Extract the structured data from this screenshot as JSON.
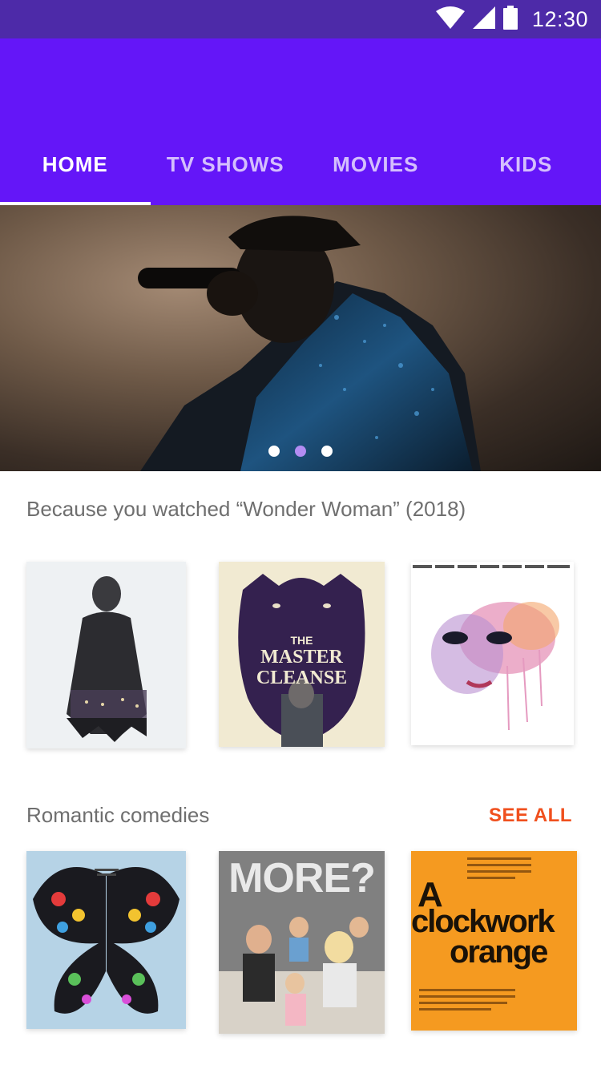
{
  "status_bar": {
    "time": "12:30",
    "icons": [
      "wifi-icon",
      "signal-icon",
      "battery-icon"
    ]
  },
  "tabs": [
    {
      "label": "HOME",
      "active": true
    },
    {
      "label": "TV SHOWS",
      "active": false
    },
    {
      "label": "MOVIES",
      "active": false
    },
    {
      "label": "KIDS",
      "active": false
    }
  ],
  "hero": {
    "slide_count": 3,
    "active_index": 1
  },
  "sections": [
    {
      "title": "Because you watched “Wonder Woman” (2018)",
      "posters": [
        {
          "name": "poster-man-in-coat"
        },
        {
          "name": "poster-master-cleanse",
          "title_line1": "THE",
          "title_line2": "MASTER",
          "title_line3": "CLEANSE"
        },
        {
          "name": "poster-watercolor-face"
        }
      ]
    },
    {
      "title": "Romantic comedies",
      "see_all": "SEE ALL",
      "posters": [
        {
          "name": "poster-butterfly"
        },
        {
          "name": "poster-more",
          "title": "MORE?"
        },
        {
          "name": "poster-clockwork-orange",
          "title_line1": "A",
          "title_line2": "clockwork",
          "title_line3": "orange"
        }
      ]
    }
  ],
  "colors": {
    "status_bar": "#4d2aa8",
    "app_bar": "#6416f8",
    "accent": "#f0501e",
    "active_dot": "#b38cf2"
  }
}
